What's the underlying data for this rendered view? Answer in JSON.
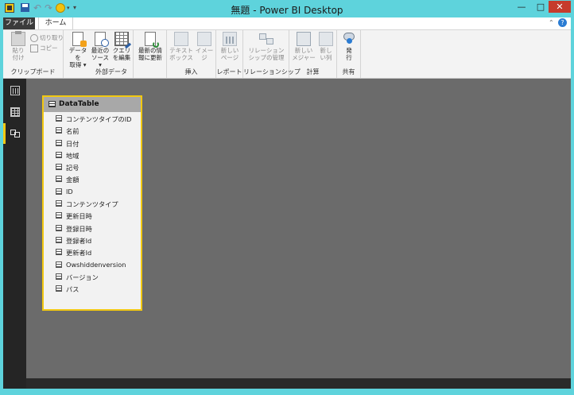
{
  "window": {
    "title": "無題 - Power BI Desktop",
    "controls": {
      "minimize": "—",
      "maximize": "□",
      "close": "✕"
    }
  },
  "qat": {
    "undo_glyph": "↶",
    "redo_glyph": "↷",
    "dropdown_glyph": "▾",
    "more_glyph": "▾"
  },
  "tabs": {
    "file": "ファイル",
    "home": "ホーム",
    "collapse_glyph": "⌃",
    "help_glyph": "?"
  },
  "ribbon": {
    "groups": [
      {
        "label": "クリップボード",
        "buttons": [
          {
            "label": "貼り\n付け",
            "icon": "paste-icon",
            "enabled": false
          }
        ],
        "small": [
          {
            "label": "切り取り",
            "icon": "cut-icon"
          },
          {
            "label": "コピー",
            "icon": "copy-icon"
          }
        ]
      },
      {
        "label": "外部データ",
        "buttons": [
          {
            "label": "データを\n取得 ▾",
            "icon": "get-data-icon",
            "enabled": true
          },
          {
            "label": "最近の\nソース ▾",
            "icon": "recent-sources-icon",
            "enabled": true
          },
          {
            "label": "クエリ\nを編集",
            "icon": "edit-queries-icon",
            "enabled": true
          }
        ]
      },
      {
        "label": "",
        "buttons": [
          {
            "label": "最新の情\n報に更新",
            "icon": "refresh-icon",
            "enabled": true
          }
        ]
      },
      {
        "label": "挿入",
        "buttons": [
          {
            "label": "テキスト\nボックス",
            "icon": "textbox-icon",
            "enabled": false
          },
          {
            "label": "イメー\nジ",
            "icon": "image-icon",
            "enabled": false
          }
        ]
      },
      {
        "label": "レポート",
        "buttons": [
          {
            "label": "新しい\nページ",
            "icon": "new-page-icon",
            "enabled": false
          }
        ]
      },
      {
        "label": "リレーションシップ",
        "buttons": [
          {
            "label": "リレーション\nシップの管理",
            "icon": "manage-relationships-icon",
            "enabled": false
          }
        ]
      },
      {
        "label": "計算",
        "buttons": [
          {
            "label": "新しい\nメジャー",
            "icon": "new-measure-icon",
            "enabled": false
          },
          {
            "label": "新し\nい列",
            "icon": "new-column-icon",
            "enabled": false
          }
        ]
      },
      {
        "label": "共有",
        "buttons": [
          {
            "label": "発\n行",
            "icon": "publish-icon",
            "enabled": true
          }
        ]
      }
    ]
  },
  "leftrail": {
    "items": [
      {
        "name": "report-view",
        "icon": "report-view-icon",
        "active": false
      },
      {
        "name": "data-view",
        "icon": "data-view-icon",
        "active": false
      },
      {
        "name": "relationships-view",
        "icon": "relationships-view-icon",
        "active": true
      }
    ]
  },
  "model": {
    "accent_color": "#f2c811",
    "table": {
      "name": "DataTable",
      "fields": [
        "コンテンツタイプのID",
        "名前",
        "日付",
        "地域",
        "記号",
        "金額",
        "ID",
        "コンテンツタイプ",
        "更新日時",
        "登録日時",
        "登録者Id",
        "更新者Id",
        "Owshiddenversion",
        "バージョン",
        "パス"
      ]
    }
  }
}
